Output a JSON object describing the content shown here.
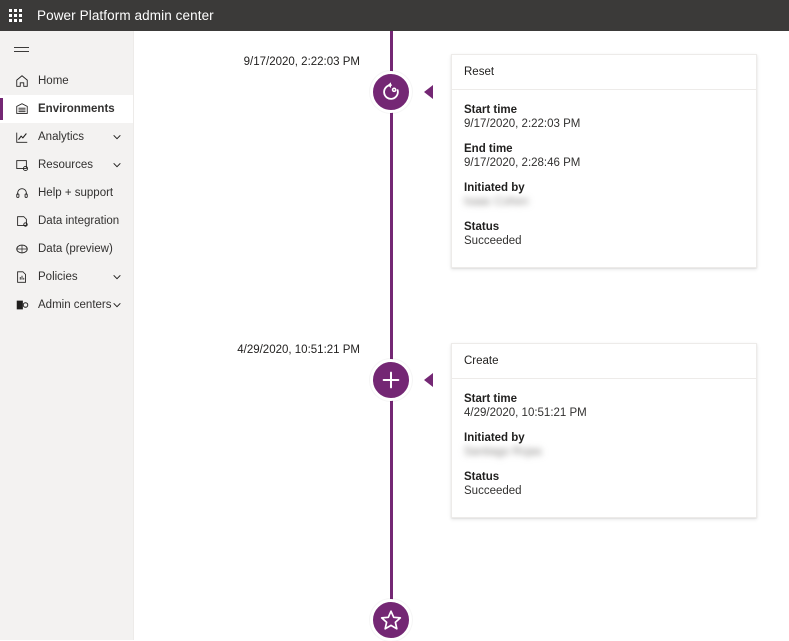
{
  "header": {
    "title": "Power Platform admin center",
    "waffle_icon": "app-launcher-waffle-icon"
  },
  "sidebar": {
    "menu_toggle_icon": "hamburger-menu-icon",
    "items": [
      {
        "label": "Home",
        "icon": "home-icon",
        "expandable": false,
        "selected": false
      },
      {
        "label": "Environments",
        "icon": "environments-icon",
        "expandable": false,
        "selected": true
      },
      {
        "label": "Analytics",
        "icon": "analytics-chart-icon",
        "expandable": true,
        "selected": false
      },
      {
        "label": "Resources",
        "icon": "resources-icon",
        "expandable": true,
        "selected": false
      },
      {
        "label": "Help + support",
        "icon": "headset-support-icon",
        "expandable": false,
        "selected": false
      },
      {
        "label": "Data integration",
        "icon": "data-integration-icon",
        "expandable": false,
        "selected": false
      },
      {
        "label": "Data (preview)",
        "icon": "data-cloud-icon",
        "expandable": false,
        "selected": false
      },
      {
        "label": "Policies",
        "icon": "policies-doc-icon",
        "expandable": true,
        "selected": false
      },
      {
        "label": "Admin centers",
        "icon": "admin-centers-icon",
        "expandable": true,
        "selected": false
      }
    ]
  },
  "colors": {
    "accent_purple": "#742774",
    "header_bar": "#3b3a39",
    "sidebar_bg": "#f3f2f1",
    "card_border": "#edebe9"
  },
  "timeline": {
    "events": [
      {
        "timestamp_label": "9/17/2020, 2:22:03 PM",
        "node_icon": "reset-circular-arrow-icon",
        "card": {
          "title": "Reset",
          "fields": [
            {
              "label": "Start time",
              "value": "9/17/2020, 2:22:03 PM",
              "redacted": false
            },
            {
              "label": "End time",
              "value": "9/17/2020, 2:28:46 PM",
              "redacted": false
            },
            {
              "label": "Initiated by",
              "value": "Isaac Cohen",
              "redacted": true
            },
            {
              "label": "Status",
              "value": "Succeeded",
              "redacted": false
            }
          ]
        }
      },
      {
        "timestamp_label": "4/29/2020, 10:51:21 PM",
        "node_icon": "create-plus-icon",
        "card": {
          "title": "Create",
          "fields": [
            {
              "label": "Start time",
              "value": "4/29/2020, 10:51:21 PM",
              "redacted": false
            },
            {
              "label": "Initiated by",
              "value": "Santiago Rojas",
              "redacted": true
            },
            {
              "label": "Status",
              "value": "Succeeded",
              "redacted": false
            }
          ]
        }
      }
    ],
    "origin_node": {
      "node_icon": "star-origin-icon"
    }
  }
}
